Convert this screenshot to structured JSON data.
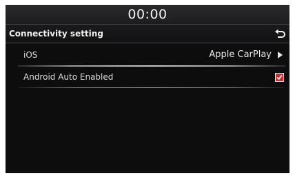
{
  "status": {
    "clock": "00:00"
  },
  "header": {
    "title": "Connectivity setting",
    "back_icon": "back-return-icon"
  },
  "settings": [
    {
      "label": "iOS",
      "value": "Apple CarPlay",
      "icon": "chevron-right-icon"
    },
    {
      "label": "Android Auto Enabled",
      "checked": true,
      "icon": "checkbox-checked-icon"
    }
  ],
  "colors": {
    "accent": "#d9262c",
    "background": "#0d0d0e",
    "text": "#e6e6e6"
  }
}
